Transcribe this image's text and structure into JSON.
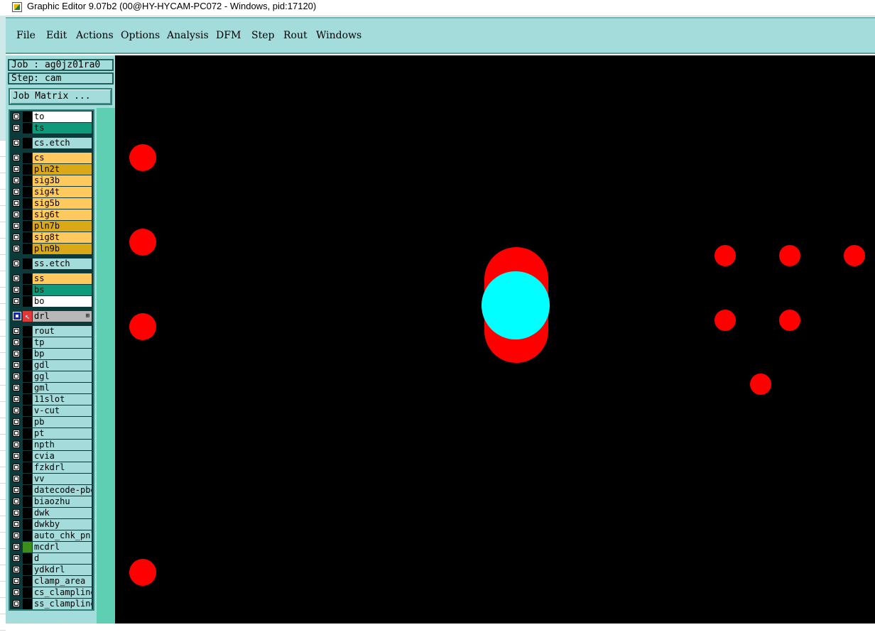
{
  "window": {
    "title": "Graphic Editor 9.07b2 (00@HY-HYCAM-PC072 - Windows, pid:17120)"
  },
  "menu": {
    "items": [
      {
        "id": "file",
        "label": "File"
      },
      {
        "id": "edit",
        "label": "Edit"
      },
      {
        "id": "actions",
        "label": "Actions"
      },
      {
        "id": "options",
        "label": "Options"
      },
      {
        "id": "analysis",
        "label": "Analysis"
      },
      {
        "id": "dfm",
        "label": "DFM"
      },
      {
        "id": "step",
        "label": "Step"
      },
      {
        "id": "rout",
        "label": "Rout"
      },
      {
        "id": "windows",
        "label": "Windows"
      }
    ]
  },
  "panel": {
    "job_label": "Job : ag0jz01ra0",
    "step_label": "Step: cam",
    "job_matrix_button": "Job Matrix ..."
  },
  "layers": [
    {
      "name": "to",
      "color": "white"
    },
    {
      "name": "ts",
      "color": "green"
    },
    {
      "name": "cs.etch",
      "color": "cyan"
    },
    {
      "name": "cs",
      "color": "orange"
    },
    {
      "name": "pln2t",
      "color": "gold"
    },
    {
      "name": "sig3b",
      "color": "orange"
    },
    {
      "name": "sig4t",
      "color": "orange"
    },
    {
      "name": "sig5b",
      "color": "orange"
    },
    {
      "name": "sig6t",
      "color": "orange"
    },
    {
      "name": "pln7b",
      "color": "gold"
    },
    {
      "name": "sig8t",
      "color": "orange"
    },
    {
      "name": "pln9b",
      "color": "gold"
    },
    {
      "name": "ss.etch",
      "color": "cyan"
    },
    {
      "name": "ss",
      "color": "orange"
    },
    {
      "name": "bs",
      "color": "green"
    },
    {
      "name": "bo",
      "color": "white"
    },
    {
      "name": "drl",
      "color": "gray",
      "active": true
    },
    {
      "name": "rout",
      "color": "cyan"
    },
    {
      "name": "tp",
      "color": "cyan"
    },
    {
      "name": "bp",
      "color": "cyan"
    },
    {
      "name": "gdl",
      "color": "cyan"
    },
    {
      "name": "ggl",
      "color": "cyan"
    },
    {
      "name": "gml",
      "color": "cyan"
    },
    {
      "name": "11slot",
      "color": "cyan"
    },
    {
      "name": "v-cut",
      "color": "cyan"
    },
    {
      "name": "pb",
      "color": "cyan"
    },
    {
      "name": "pt",
      "color": "cyan"
    },
    {
      "name": "npth",
      "color": "cyan"
    },
    {
      "name": "cvia",
      "color": "cyan"
    },
    {
      "name": "fzkdrl",
      "color": "cyan"
    },
    {
      "name": "vv",
      "color": "cyan"
    },
    {
      "name": "datecode-pbe",
      "color": "cyan"
    },
    {
      "name": "biaozhu",
      "color": "cyan"
    },
    {
      "name": "dwk",
      "color": "cyan"
    },
    {
      "name": "dwkby",
      "color": "cyan"
    },
    {
      "name": "auto_chk_pnl",
      "color": "cyan"
    },
    {
      "name": "mcdrl",
      "color": "cyan",
      "indicator": "green"
    },
    {
      "name": "d",
      "color": "cyan"
    },
    {
      "name": "ydkdrl",
      "color": "cyan"
    },
    {
      "name": "clamp_area",
      "color": "cyan"
    },
    {
      "name": "cs_clampline",
      "color": "cyan"
    },
    {
      "name": "ss_clampline",
      "color": "cyan"
    }
  ],
  "colors": {
    "white": "#ffffff",
    "green": "#109a7c",
    "cyan": "#a3dcdb",
    "orange": "#ffc95e",
    "gold": "#dba917",
    "gray": "#b8b8b8",
    "pad_red": "#ff0000",
    "pad_cyan": "#00ffff",
    "canvas_bg": "#000000"
  }
}
